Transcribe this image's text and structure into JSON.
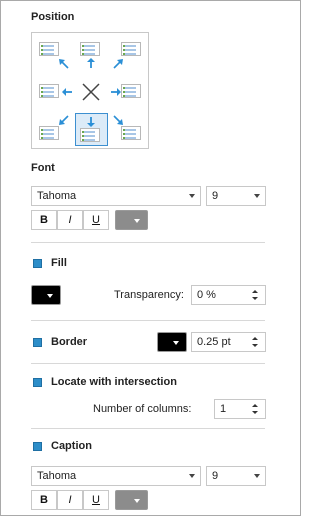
{
  "position": {
    "title": "Position"
  },
  "font": {
    "title": "Font",
    "family": "Tahoma",
    "size": "9",
    "bold": "B",
    "italic": "I",
    "underline": "U",
    "color": "#8c8c8c"
  },
  "fill": {
    "title": "Fill",
    "color": "#000000",
    "transparency_label": "Transparency:",
    "transparency_value": "0 %"
  },
  "border": {
    "title": "Border",
    "color": "#000000",
    "width": "0.25 pt"
  },
  "locate": {
    "title": "Locate with intersection",
    "columns_label": "Number of columns:",
    "columns_value": "1"
  },
  "caption": {
    "title": "Caption",
    "family": "Tahoma",
    "size": "9",
    "bold": "B",
    "italic": "I",
    "underline": "U",
    "color": "#8c8c8c"
  },
  "icons": {
    "accent": "#2b8fd6",
    "checkbox": "#2d8ec9"
  }
}
